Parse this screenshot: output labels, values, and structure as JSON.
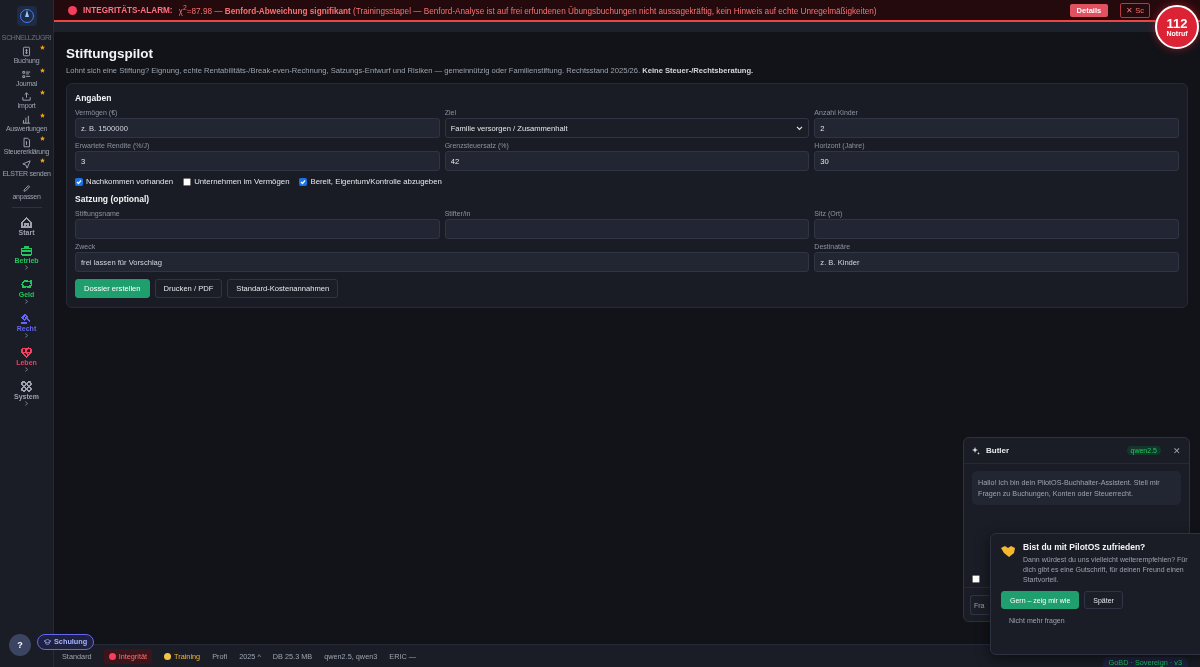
{
  "alarm": {
    "title": "INTEGRITÄTS-ALARM:",
    "text": "χ$^{2}$=87.98 — **Benford-Abweichung signifikant** (Trainingsstapel — Benford-Analyse ist auf frei erfundenen Übungsbuchungen nicht aussagekräftig, kein Hinweis auf echte Unregelmäßigkeiten)",
    "details_button": "Details",
    "close_button": "✕ Sc"
  },
  "emergency": {
    "number": "112",
    "label": "Notruf"
  },
  "sidebar": {
    "section_label": "SCHNELLZUGRI",
    "quick": [
      {
        "label": "Buchung",
        "starred": true
      },
      {
        "label": "Journal",
        "starred": true
      },
      {
        "label": "Import",
        "starred": true
      },
      {
        "label": "Auswertungen",
        "starred": true
      },
      {
        "label": "Steuererklärung",
        "starred": true
      },
      {
        "label": "ELSTER senden",
        "starred": true
      },
      {
        "label": "anpassen",
        "starred": false
      }
    ],
    "areas": [
      {
        "label": "Start",
        "color": "#9ca3af"
      },
      {
        "label": "Betrieb",
        "color": "#22c55e"
      },
      {
        "label": "Geld",
        "color": "#22c55e"
      },
      {
        "label": "Recht",
        "color": "#6366f1"
      },
      {
        "label": "Leben",
        "color": "#f43f5e"
      },
      {
        "label": "System",
        "color": "#9ca3af"
      }
    ]
  },
  "page": {
    "title": "Stiftungspilot",
    "subtitle": "Lohnt sich eine Stiftung? Eignung, echte Rentabilitäts-/Break-even-Rechnung, Satzungs-Entwurf und Risiken — gemeinnützig oder Familienstiftung. Rechtsstand 2025/26. **Keine Steuer-/Rechtsberatung.**"
  },
  "form": {
    "heading": "Angaben",
    "fields": [
      {
        "label": "Vermögen (€)",
        "kind": "input",
        "placeholder": "z. B. 1500000"
      },
      {
        "label": "Ziel",
        "kind": "select",
        "value": "Familie versorgen / Zusammenhalt"
      },
      {
        "label": "Anzahl Kinder",
        "kind": "input",
        "value": "2"
      },
      {
        "label": "Erwartete Rendite (%/J)",
        "kind": "input",
        "value": "3"
      },
      {
        "label": "Grenzsteuersatz (%)",
        "kind": "input",
        "value": "42"
      },
      {
        "label": "Horizont (Jahre)",
        "kind": "input",
        "value": "30"
      }
    ],
    "checkboxes": [
      {
        "label": "Nachkommen vorhanden",
        "checked": true
      },
      {
        "label": "Unternehmen im Vermögen",
        "checked": false
      },
      {
        "label": "Bereit, Eigentum/Kontrolle abzugeben",
        "checked": true
      }
    ],
    "statute_heading": "Satzung (optional)",
    "statute_fields": [
      {
        "label": "Stiftungsname",
        "kind": "input"
      },
      {
        "label": "Stifter/in",
        "kind": "input"
      },
      {
        "label": "Sitz (Ort)",
        "kind": "input"
      },
      {
        "label": "Zweck",
        "kind": "wide-input",
        "placeholder": "frei lassen für Vorschlag"
      },
      {
        "label": "Destinatäre",
        "kind": "input",
        "placeholder": "z. B. Kinder"
      }
    ],
    "buttons": [
      {
        "label": "Dossier erstellen",
        "kind": "primary"
      },
      {
        "label": "Drucken / PDF",
        "kind": "secondary"
      },
      {
        "label": "Standard-Kostenannahmen",
        "kind": "secondary"
      }
    ]
  },
  "butler": {
    "title": "Butler",
    "model_badge": "qwen2.5",
    "close": "✕",
    "message": "Hallo! Ich bin dein PilotOS-Buchhalter-Assistent. Stell mir Fragen zu Buchungen, Konten oder Steuerrecht.",
    "checkbox": {
      "checked": false
    },
    "input_placeholder": "Fra"
  },
  "rating": {
    "title": "Bist du mit PilotOS zufrieden?",
    "text": "Dann würdest du uns vielleicht weiterempfehlen? Für dich gibt es eine Gutschrift, für deinen Freund einen Startvorteil.",
    "buttons": [
      {
        "label": "Gern – zeig mir wie",
        "kind": "primary"
      },
      {
        "label": "Später",
        "kind": "secondary"
      }
    ],
    "dismiss": "Nicht mehr fragen"
  },
  "help": {
    "label": "?"
  },
  "training_pill": {
    "label": "Schulung"
  },
  "status_bar": {
    "items": [
      {
        "label": "Standard",
        "kind": "plain"
      },
      {
        "label": "Integrität",
        "kind": "alert"
      },
      {
        "label": "Training",
        "kind": "warning"
      },
      {
        "label": "Profi",
        "kind": "plain"
      },
      {
        "label": "2025 ^",
        "kind": "plain"
      },
      {
        "label": "DB 25.3 MB",
        "kind": "plain"
      },
      {
        "label": "qwen2.5, qwen3",
        "kind": "plain"
      },
      {
        "label": "ERIC —",
        "kind": "plain"
      }
    ],
    "version": "GoBD · Sovereign · v3"
  }
}
